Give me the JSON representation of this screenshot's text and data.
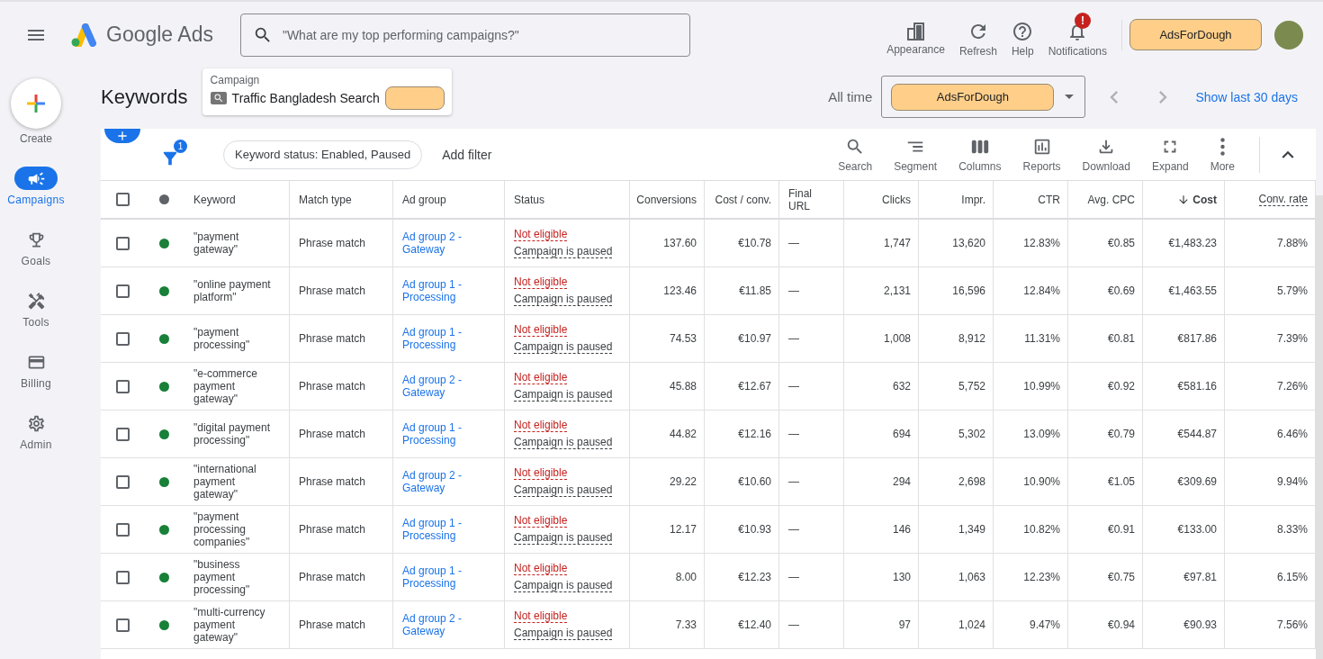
{
  "header": {
    "product": "Google Ads",
    "search": {
      "placeholder": "\"What are my top performing campaigns?\""
    },
    "actions": [
      {
        "kind": "appearance",
        "label": "Appearance"
      },
      {
        "kind": "refresh",
        "label": "Refresh"
      },
      {
        "kind": "help",
        "label": "Help"
      },
      {
        "kind": "notifications",
        "label": "Notifications",
        "badge": "!"
      }
    ],
    "account": "AdsForDough"
  },
  "sidebar": {
    "create": "Create",
    "items": [
      {
        "kind": "campaigns",
        "label": "Campaigns",
        "selected": true
      },
      {
        "kind": "goals",
        "label": "Goals",
        "selected": false
      },
      {
        "kind": "tools",
        "label": "Tools",
        "selected": false
      },
      {
        "kind": "billing",
        "label": "Billing",
        "selected": false
      },
      {
        "kind": "admin",
        "label": "Admin",
        "selected": false
      }
    ]
  },
  "page": {
    "title": "Keywords",
    "campaign": {
      "label": "Campaign",
      "name": "Traffic Bangladesh Search"
    },
    "date": {
      "range": "All time",
      "selector": "AdsForDough",
      "link": "Show last 30 days"
    }
  },
  "toolbar": {
    "filter_count": "1",
    "filter_chip": "Keyword status: Enabled, Paused",
    "add_filter": "Add filter",
    "tools": [
      {
        "kind": "search",
        "label": "Search"
      },
      {
        "kind": "segment",
        "label": "Segment"
      },
      {
        "kind": "columns",
        "label": "Columns"
      },
      {
        "kind": "reports",
        "label": "Reports"
      },
      {
        "kind": "download",
        "label": "Download"
      },
      {
        "kind": "expand",
        "label": "Expand"
      },
      {
        "kind": "more",
        "label": "More"
      }
    ]
  },
  "table": {
    "select_all_checked": false,
    "columns": [
      {
        "label": "Keyword",
        "sorted": false,
        "underlined": false
      },
      {
        "label": "Match type",
        "sorted": false,
        "underlined": false
      },
      {
        "label": "Ad group",
        "sorted": false,
        "underlined": false
      },
      {
        "label": "Status",
        "sorted": false,
        "underlined": false
      },
      {
        "label": "Conversions",
        "sorted": false,
        "underlined": false
      },
      {
        "label": "Cost / conv.",
        "sorted": false,
        "underlined": false
      },
      {
        "label": "Final URL",
        "sorted": false,
        "underlined": false
      },
      {
        "label": "Clicks",
        "sorted": false,
        "underlined": false
      },
      {
        "label": "Impr.",
        "sorted": false,
        "underlined": false
      },
      {
        "label": "CTR",
        "sorted": false,
        "underlined": false
      },
      {
        "label": "Avg. CPC",
        "sorted": false,
        "underlined": false
      },
      {
        "label": "Cost",
        "sorted": true,
        "underlined": false
      },
      {
        "label": "Conv. rate",
        "sorted": false,
        "underlined": true
      }
    ],
    "rows": [
      {
        "checked": false,
        "enabled": true,
        "keyword": "\"payment gateway\"",
        "match_type": "Phrase match",
        "ad_group": "Ad group 2 - Gateway",
        "status": "Not eligible",
        "status_reason": "Campaign is paused",
        "metrics": [
          "137.60",
          "€10.78",
          "—",
          "1,747",
          "13,620",
          "12.83%",
          "€0.85",
          "€1,483.23",
          "7.88%"
        ]
      },
      {
        "checked": false,
        "enabled": true,
        "keyword": "\"online payment platform\"",
        "match_type": "Phrase match",
        "ad_group": "Ad group 1 - Processing",
        "status": "Not eligible",
        "status_reason": "Campaign is paused",
        "metrics": [
          "123.46",
          "€11.85",
          "—",
          "2,131",
          "16,596",
          "12.84%",
          "€0.69",
          "€1,463.55",
          "5.79%"
        ]
      },
      {
        "checked": false,
        "enabled": true,
        "keyword": "\"payment processing\"",
        "match_type": "Phrase match",
        "ad_group": "Ad group 1 - Processing",
        "status": "Not eligible",
        "status_reason": "Campaign is paused",
        "metrics": [
          "74.53",
          "€10.97",
          "—",
          "1,008",
          "8,912",
          "11.31%",
          "€0.81",
          "€817.86",
          "7.39%"
        ]
      },
      {
        "checked": false,
        "enabled": true,
        "keyword": "\"e-commerce payment gateway\"",
        "match_type": "Phrase match",
        "ad_group": "Ad group 2 - Gateway",
        "status": "Not eligible",
        "status_reason": "Campaign is paused",
        "metrics": [
          "45.88",
          "€12.67",
          "—",
          "632",
          "5,752",
          "10.99%",
          "€0.92",
          "€581.16",
          "7.26%"
        ]
      },
      {
        "checked": false,
        "enabled": true,
        "keyword": "\"digital payment processing\"",
        "match_type": "Phrase match",
        "ad_group": "Ad group 1 - Processing",
        "status": "Not eligible",
        "status_reason": "Campaign is paused",
        "metrics": [
          "44.82",
          "€12.16",
          "—",
          "694",
          "5,302",
          "13.09%",
          "€0.79",
          "€544.87",
          "6.46%"
        ]
      },
      {
        "checked": false,
        "enabled": true,
        "keyword": "\"international payment gateway\"",
        "match_type": "Phrase match",
        "ad_group": "Ad group 2 - Gateway",
        "status": "Not eligible",
        "status_reason": "Campaign is paused",
        "metrics": [
          "29.22",
          "€10.60",
          "—",
          "294",
          "2,698",
          "10.90%",
          "€1.05",
          "€309.69",
          "9.94%"
        ]
      },
      {
        "checked": false,
        "enabled": true,
        "keyword": "\"payment processing companies\"",
        "match_type": "Phrase match",
        "ad_group": "Ad group 1 - Processing",
        "status": "Not eligible",
        "status_reason": "Campaign is paused",
        "metrics": [
          "12.17",
          "€10.93",
          "—",
          "146",
          "1,349",
          "10.82%",
          "€0.91",
          "€133.00",
          "8.33%"
        ]
      },
      {
        "checked": false,
        "enabled": true,
        "keyword": "\"business payment processing\"",
        "match_type": "Phrase match",
        "ad_group": "Ad group 1 - Processing",
        "status": "Not eligible",
        "status_reason": "Campaign is paused",
        "metrics": [
          "8.00",
          "€12.23",
          "—",
          "130",
          "1,063",
          "12.23%",
          "€0.75",
          "€97.81",
          "6.15%"
        ]
      },
      {
        "checked": false,
        "enabled": true,
        "keyword": "\"multi-currency payment gateway\"",
        "match_type": "Phrase match",
        "ad_group": "Ad group 2 - Gateway",
        "status": "Not eligible",
        "status_reason": "Campaign is paused",
        "metrics": [
          "7.33",
          "€12.40",
          "—",
          "97",
          "1,024",
          "9.47%",
          "€0.94",
          "€90.93",
          "7.56%"
        ]
      }
    ]
  }
}
